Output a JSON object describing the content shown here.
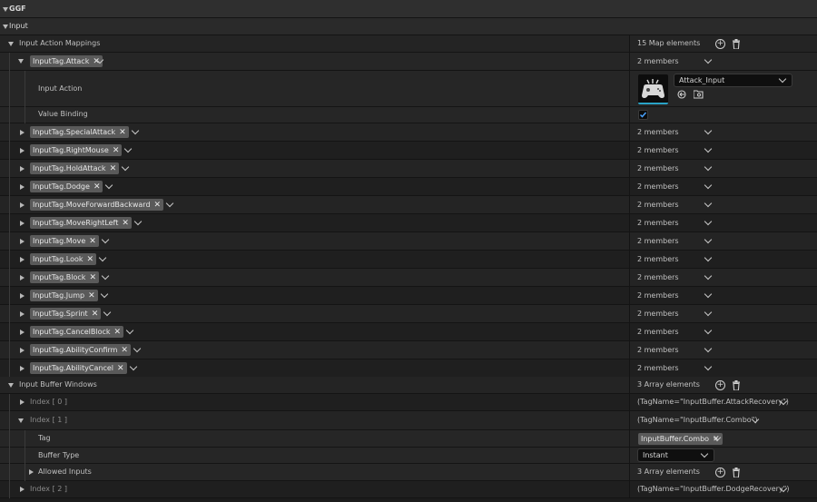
{
  "header": {
    "ggf_label": "GGF",
    "input_label": "Input"
  },
  "mappings": {
    "label": "Input Action Mappings",
    "count_text": "15 Map elements",
    "expanded_key": "InputTag.Attack",
    "expanded_value": "2 members",
    "input_action_label": "Input Action",
    "input_action_value": "Attack_Input",
    "value_binding_label": "Value Binding",
    "value_binding_checked": true,
    "items": [
      {
        "tag": "InputTag.SpecialAttack",
        "value": "2 members"
      },
      {
        "tag": "InputTag.RightMouse",
        "value": "2 members"
      },
      {
        "tag": "InputTag.HoldAttack",
        "value": "2 members"
      },
      {
        "tag": "InputTag.Dodge",
        "value": "2 members"
      },
      {
        "tag": "InputTag.MoveForwardBackward",
        "value": "2 members"
      },
      {
        "tag": "InputTag.MoveRightLeft",
        "value": "2 members"
      },
      {
        "tag": "InputTag.Move",
        "value": "2 members"
      },
      {
        "tag": "InputTag.Look",
        "value": "2 members"
      },
      {
        "tag": "InputTag.Block",
        "value": "2 members"
      },
      {
        "tag": "InputTag.Jump",
        "value": "2 members"
      },
      {
        "tag": "InputTag.Sprint",
        "value": "2 members"
      },
      {
        "tag": "InputTag.CancelBlock",
        "value": "2 members"
      },
      {
        "tag": "InputTag.AbilityConfirm",
        "value": "2 members"
      },
      {
        "tag": "InputTag.AbilityCancel",
        "value": "2 members"
      }
    ]
  },
  "buffers": {
    "label": "Input Buffer Windows",
    "count_text": "3 Array elements",
    "index0_label": "Index [ 0 ]",
    "index0_value": "(TagName=\"InputBuffer.AttackRecovery\")",
    "index1_label": "Index [ 1 ]",
    "index1_value": "(TagName=\"InputBuffer.Combo\")",
    "tag_label": "Tag",
    "tag_chip": "InputBuffer.Combo",
    "buffer_type_label": "Buffer Type",
    "buffer_type_value": "Instant",
    "allowed_inputs_label": "Allowed Inputs",
    "allowed_inputs_count": "3 Array elements",
    "index2_label": "Index [ 2 ]",
    "index2_value": "(TagName=\"InputBuffer.DodgeRecovery\")"
  },
  "icons": [
    "add-icon",
    "trash-icon",
    "chevron-down-icon",
    "close-icon",
    "gamepad-icon",
    "browse-icon",
    "use-selected-icon",
    "check-icon"
  ],
  "colors": {
    "accent": "#2aa3c6",
    "chip_bg": "#5a5a5a",
    "panel_bg": "#1c1c1c"
  }
}
